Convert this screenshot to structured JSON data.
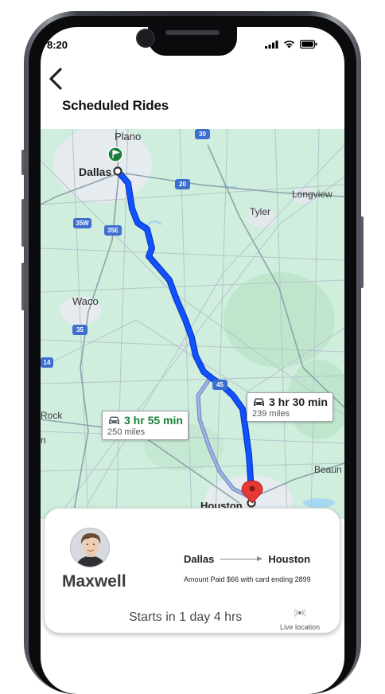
{
  "status_bar": {
    "time": "8:20"
  },
  "header": {
    "title": "Scheduled Rides"
  },
  "map": {
    "cities": [
      "Plano",
      "Dallas",
      "Longview",
      "Tyler",
      "Waco",
      "Houston",
      "Beaun",
      "Rock",
      "n"
    ],
    "highway_shields": [
      "30",
      "20",
      "35W",
      "35E",
      "35",
      "45",
      "14"
    ],
    "routes": [
      {
        "time": "3 hr 30 min",
        "distance": "239 miles",
        "color": "#1a73e8",
        "selected": true
      },
      {
        "time": "3 hr 55 min",
        "distance": "250 miles",
        "color": "#188038",
        "selected": false
      }
    ]
  },
  "ride": {
    "driver_name": "Maxwell",
    "origin": "Dallas",
    "destination": "Houston",
    "payment": "Amount Paid $66 with card ending 2899",
    "starts_in": "Starts in 1 day 4 hrs",
    "live_location_label": "Live location"
  },
  "colors": {
    "route_primary": "#0f4cf7",
    "route_alt": "#9fb3ef",
    "map_background": "#cfeedd",
    "destination_pin": "#e53935",
    "start_flag": "#188038"
  }
}
